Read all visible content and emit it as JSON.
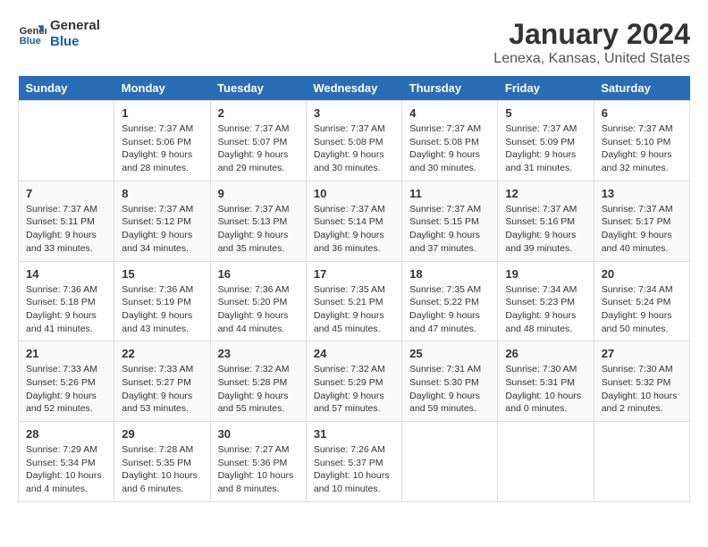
{
  "logo": {
    "line1": "General",
    "line2": "Blue"
  },
  "title": "January 2024",
  "subtitle": "Lenexa, Kansas, United States",
  "days_header": [
    "Sunday",
    "Monday",
    "Tuesday",
    "Wednesday",
    "Thursday",
    "Friday",
    "Saturday"
  ],
  "weeks": [
    [
      {
        "day": "",
        "sunrise": "",
        "sunset": "",
        "daylight": ""
      },
      {
        "day": "1",
        "sunrise": "Sunrise: 7:37 AM",
        "sunset": "Sunset: 5:06 PM",
        "daylight": "Daylight: 9 hours and 28 minutes."
      },
      {
        "day": "2",
        "sunrise": "Sunrise: 7:37 AM",
        "sunset": "Sunset: 5:07 PM",
        "daylight": "Daylight: 9 hours and 29 minutes."
      },
      {
        "day": "3",
        "sunrise": "Sunrise: 7:37 AM",
        "sunset": "Sunset: 5:08 PM",
        "daylight": "Daylight: 9 hours and 30 minutes."
      },
      {
        "day": "4",
        "sunrise": "Sunrise: 7:37 AM",
        "sunset": "Sunset: 5:08 PM",
        "daylight": "Daylight: 9 hours and 30 minutes."
      },
      {
        "day": "5",
        "sunrise": "Sunrise: 7:37 AM",
        "sunset": "Sunset: 5:09 PM",
        "daylight": "Daylight: 9 hours and 31 minutes."
      },
      {
        "day": "6",
        "sunrise": "Sunrise: 7:37 AM",
        "sunset": "Sunset: 5:10 PM",
        "daylight": "Daylight: 9 hours and 32 minutes."
      }
    ],
    [
      {
        "day": "7",
        "sunrise": "Sunrise: 7:37 AM",
        "sunset": "Sunset: 5:11 PM",
        "daylight": "Daylight: 9 hours and 33 minutes."
      },
      {
        "day": "8",
        "sunrise": "Sunrise: 7:37 AM",
        "sunset": "Sunset: 5:12 PM",
        "daylight": "Daylight: 9 hours and 34 minutes."
      },
      {
        "day": "9",
        "sunrise": "Sunrise: 7:37 AM",
        "sunset": "Sunset: 5:13 PM",
        "daylight": "Daylight: 9 hours and 35 minutes."
      },
      {
        "day": "10",
        "sunrise": "Sunrise: 7:37 AM",
        "sunset": "Sunset: 5:14 PM",
        "daylight": "Daylight: 9 hours and 36 minutes."
      },
      {
        "day": "11",
        "sunrise": "Sunrise: 7:37 AM",
        "sunset": "Sunset: 5:15 PM",
        "daylight": "Daylight: 9 hours and 37 minutes."
      },
      {
        "day": "12",
        "sunrise": "Sunrise: 7:37 AM",
        "sunset": "Sunset: 5:16 PM",
        "daylight": "Daylight: 9 hours and 39 minutes."
      },
      {
        "day": "13",
        "sunrise": "Sunrise: 7:37 AM",
        "sunset": "Sunset: 5:17 PM",
        "daylight": "Daylight: 9 hours and 40 minutes."
      }
    ],
    [
      {
        "day": "14",
        "sunrise": "Sunrise: 7:36 AM",
        "sunset": "Sunset: 5:18 PM",
        "daylight": "Daylight: 9 hours and 41 minutes."
      },
      {
        "day": "15",
        "sunrise": "Sunrise: 7:36 AM",
        "sunset": "Sunset: 5:19 PM",
        "daylight": "Daylight: 9 hours and 43 minutes."
      },
      {
        "day": "16",
        "sunrise": "Sunrise: 7:36 AM",
        "sunset": "Sunset: 5:20 PM",
        "daylight": "Daylight: 9 hours and 44 minutes."
      },
      {
        "day": "17",
        "sunrise": "Sunrise: 7:35 AM",
        "sunset": "Sunset: 5:21 PM",
        "daylight": "Daylight: 9 hours and 45 minutes."
      },
      {
        "day": "18",
        "sunrise": "Sunrise: 7:35 AM",
        "sunset": "Sunset: 5:22 PM",
        "daylight": "Daylight: 9 hours and 47 minutes."
      },
      {
        "day": "19",
        "sunrise": "Sunrise: 7:34 AM",
        "sunset": "Sunset: 5:23 PM",
        "daylight": "Daylight: 9 hours and 48 minutes."
      },
      {
        "day": "20",
        "sunrise": "Sunrise: 7:34 AM",
        "sunset": "Sunset: 5:24 PM",
        "daylight": "Daylight: 9 hours and 50 minutes."
      }
    ],
    [
      {
        "day": "21",
        "sunrise": "Sunrise: 7:33 AM",
        "sunset": "Sunset: 5:26 PM",
        "daylight": "Daylight: 9 hours and 52 minutes."
      },
      {
        "day": "22",
        "sunrise": "Sunrise: 7:33 AM",
        "sunset": "Sunset: 5:27 PM",
        "daylight": "Daylight: 9 hours and 53 minutes."
      },
      {
        "day": "23",
        "sunrise": "Sunrise: 7:32 AM",
        "sunset": "Sunset: 5:28 PM",
        "daylight": "Daylight: 9 hours and 55 minutes."
      },
      {
        "day": "24",
        "sunrise": "Sunrise: 7:32 AM",
        "sunset": "Sunset: 5:29 PM",
        "daylight": "Daylight: 9 hours and 57 minutes."
      },
      {
        "day": "25",
        "sunrise": "Sunrise: 7:31 AM",
        "sunset": "Sunset: 5:30 PM",
        "daylight": "Daylight: 9 hours and 59 minutes."
      },
      {
        "day": "26",
        "sunrise": "Sunrise: 7:30 AM",
        "sunset": "Sunset: 5:31 PM",
        "daylight": "Daylight: 10 hours and 0 minutes."
      },
      {
        "day": "27",
        "sunrise": "Sunrise: 7:30 AM",
        "sunset": "Sunset: 5:32 PM",
        "daylight": "Daylight: 10 hours and 2 minutes."
      }
    ],
    [
      {
        "day": "28",
        "sunrise": "Sunrise: 7:29 AM",
        "sunset": "Sunset: 5:34 PM",
        "daylight": "Daylight: 10 hours and 4 minutes."
      },
      {
        "day": "29",
        "sunrise": "Sunrise: 7:28 AM",
        "sunset": "Sunset: 5:35 PM",
        "daylight": "Daylight: 10 hours and 6 minutes."
      },
      {
        "day": "30",
        "sunrise": "Sunrise: 7:27 AM",
        "sunset": "Sunset: 5:36 PM",
        "daylight": "Daylight: 10 hours and 8 minutes."
      },
      {
        "day": "31",
        "sunrise": "Sunrise: 7:26 AM",
        "sunset": "Sunset: 5:37 PM",
        "daylight": "Daylight: 10 hours and 10 minutes."
      },
      {
        "day": "",
        "sunrise": "",
        "sunset": "",
        "daylight": ""
      },
      {
        "day": "",
        "sunrise": "",
        "sunset": "",
        "daylight": ""
      },
      {
        "day": "",
        "sunrise": "",
        "sunset": "",
        "daylight": ""
      }
    ]
  ]
}
